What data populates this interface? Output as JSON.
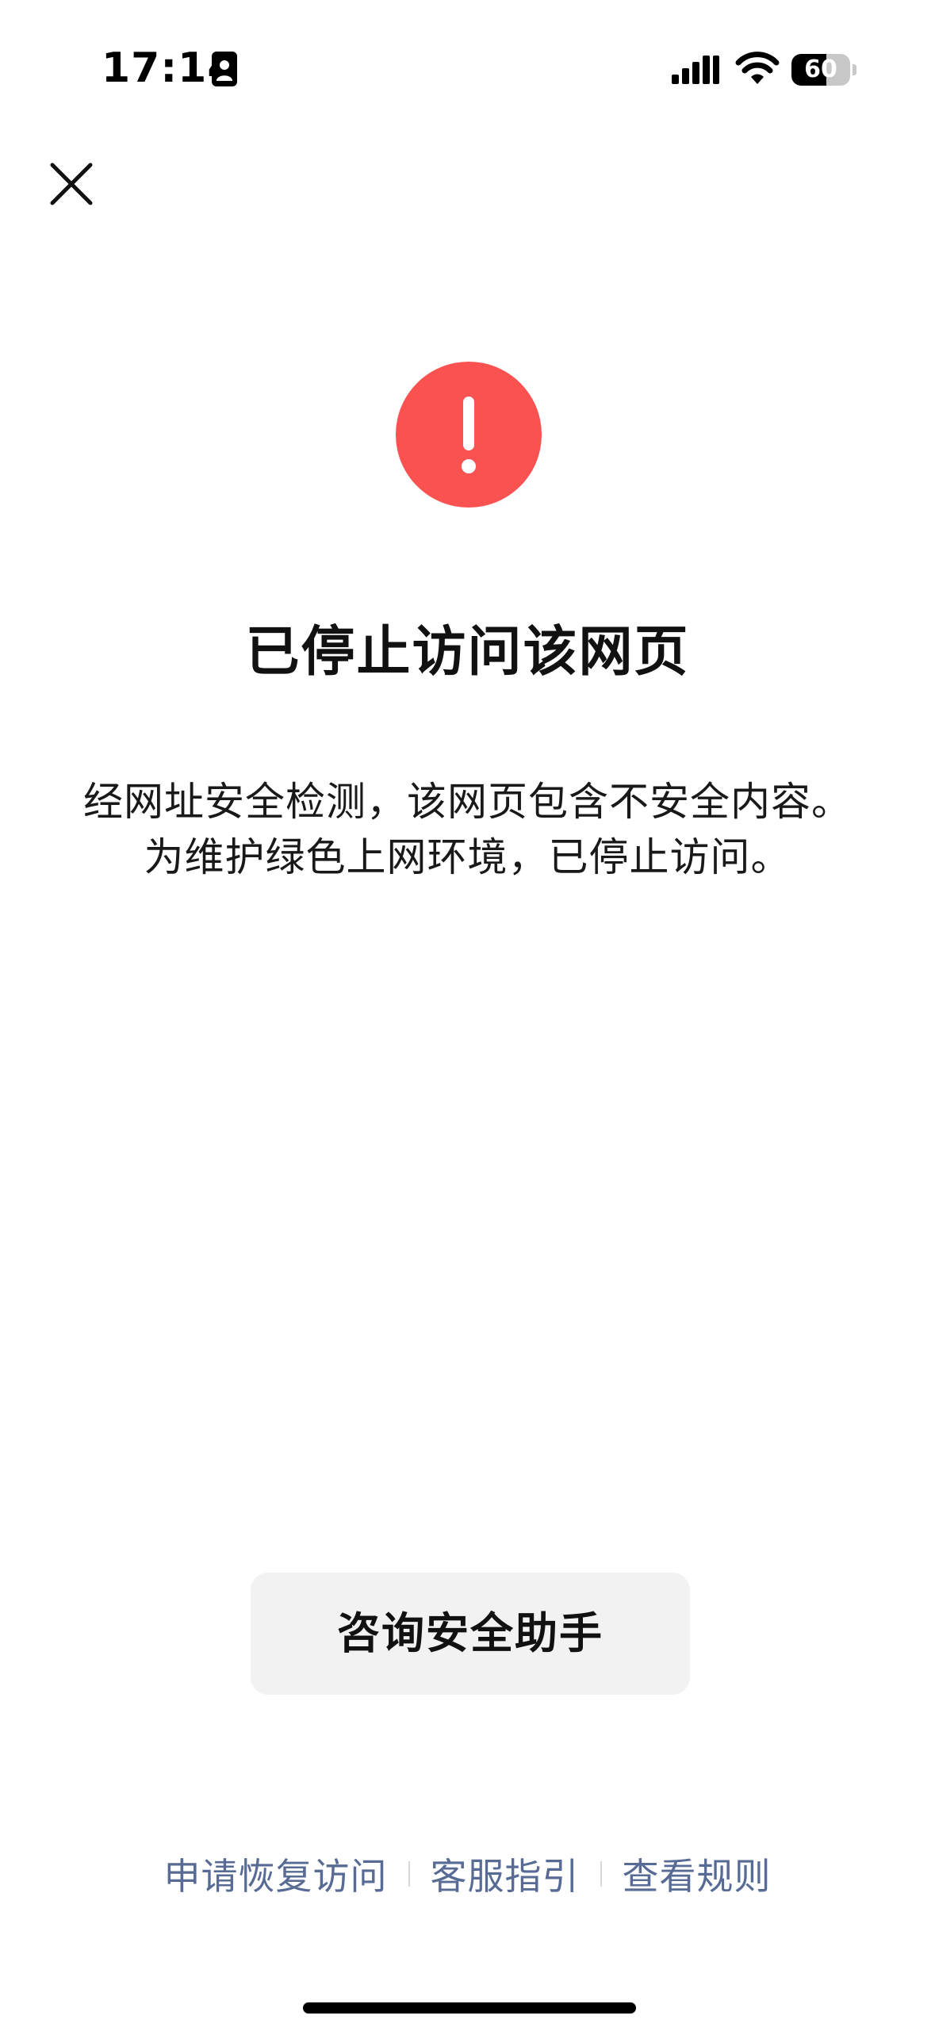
{
  "status_bar": {
    "time": "17:14",
    "battery_level": "60",
    "battery_fraction": 0.6,
    "icons": [
      "contact-card-icon",
      "signal-icon",
      "wifi-icon",
      "battery-icon"
    ]
  },
  "toolbar": {
    "close_icon": "close-icon"
  },
  "warning": {
    "icon": "exclamation-icon",
    "color": "#fa5151"
  },
  "title": "已停止访问该网页",
  "description": "经网址安全检测，该网页包含不安全内容。为维护绿色上网环境，已停止访问。",
  "primary_button": {
    "label": "咨询安全助手"
  },
  "footer_links": [
    {
      "label": "申请恢复访问"
    },
    {
      "label": "客服指引"
    },
    {
      "label": "查看规则"
    }
  ],
  "colors": {
    "link": "#576b95",
    "button_bg": "#f2f2f2"
  }
}
